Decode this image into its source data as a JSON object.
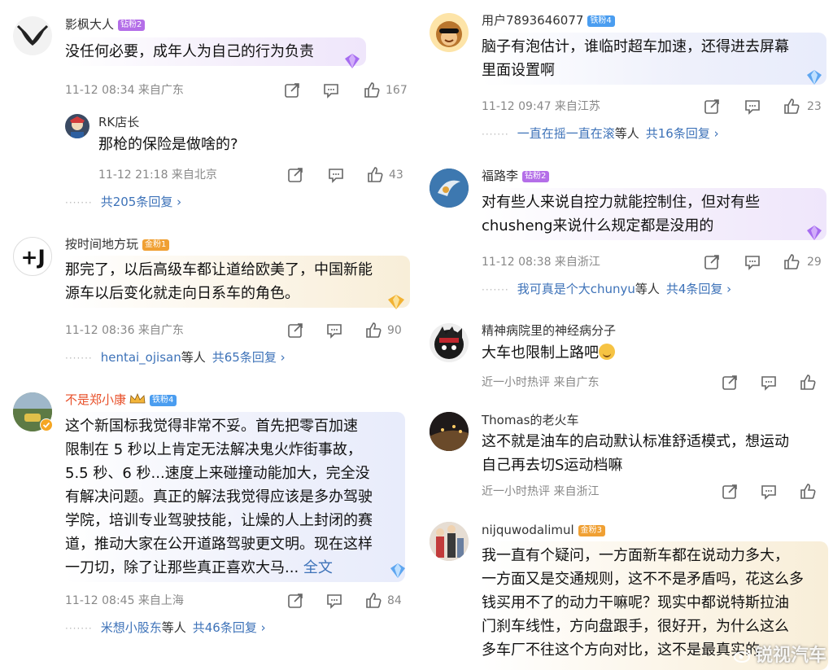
{
  "left": [
    {
      "name": "影枫大人",
      "badge": "钻粉2",
      "text": [
        "没任何必要，成年人为自己的行为负责"
      ],
      "meta": "11-12 08:34  来自广东",
      "likes": "167",
      "reply": {
        "name": "RK店长",
        "text": "那枪的保险是做啥的?",
        "meta": "11-12 21:18  来自北京",
        "likes": "43"
      },
      "replies_link": "共205条回复 ›"
    },
    {
      "name": "按时间地方玩",
      "badge": "金粉1",
      "text": [
        "那完了，以后高级车都让道给欧美了，中国新能",
        "源车以后变化就走向日系车的角色。"
      ],
      "meta": "11-12 08:36  来自广东",
      "likes": "90",
      "replies_user": "hentai_ojisan",
      "replies_mid": "等人",
      "replies_link": "共65条回复 ›"
    },
    {
      "name": "不是郑小康",
      "badge": "铁粉4",
      "text": [
        "这个新国标我觉得非常不妥。首先把零百加速",
        "限制在 5 秒以上肯定无法解决鬼火炸街事故，",
        "5.5 秒、6 秒...速度上来碰撞动能加大，完全没",
        "有解决问题。真正的解法我觉得应该是多办驾驶",
        "学院，培训专业驾驶技能，让燥的人上封闭的赛",
        "道，推动大家在公开道路驾驶更文明。现在这样",
        "一刀切，除了让那些真正喜欢大马..."
      ],
      "full_text": "全文",
      "meta": "11-12 08:45  来自上海",
      "likes": "84",
      "replies_user": "米想小股东",
      "replies_mid": "等人",
      "replies_link": "共46条回复 ›"
    }
  ],
  "right": [
    {
      "name": "用户7893646077",
      "badge": "铁粉4",
      "text": [
        "脑子有泡估计，谁临时超车加速，还得进去屏幕",
        "里面设置啊"
      ],
      "meta": "11-12 09:47  来自江苏",
      "likes": "23",
      "replies_user": "一直在摇一直在滚",
      "replies_mid": "等人",
      "replies_link": "共16条回复 ›"
    },
    {
      "name": "福路李",
      "badge": "钻粉2",
      "text": [
        "对有些人来说自控力就能控制住，但对有些",
        "chusheng来说什么规定都是没用的"
      ],
      "meta": "11-12 08:38  来自浙江",
      "likes": "29",
      "replies_user": "我可真是个大chunyu",
      "replies_mid": "等人",
      "replies_link": "共4条回复 ›"
    },
    {
      "name": "精神病院里的神经病分子",
      "text": [
        "大车也限制上路吧"
      ],
      "meta": "近一小时热评  来自广东"
    },
    {
      "name": "Thomas的老火车",
      "text": [
        "这不就是油车的启动默认标准舒适模式，想运动",
        "自己再去切S运动档嘛"
      ],
      "meta": "近一小时热评  来自浙江"
    },
    {
      "name": "nijquwodalimul",
      "badge": "金粉3",
      "text": [
        "我一直有个疑问，一方面新车都在说动力多大，",
        "一方面又是交通规则，这不不是矛盾吗，花这么多",
        "钱买用不了的动力干嘛呢？现实中都说特斯拉油",
        "门刹车线性，方向盘跟手，很好开，为什么这么",
        "多车厂不往这个方向对比，这不是最真实的"
      ]
    }
  ],
  "watermark": "锐视汽车",
  "colors": {
    "link": "#3d72b8",
    "vip_name": "#e8502a",
    "meta": "#888888"
  }
}
